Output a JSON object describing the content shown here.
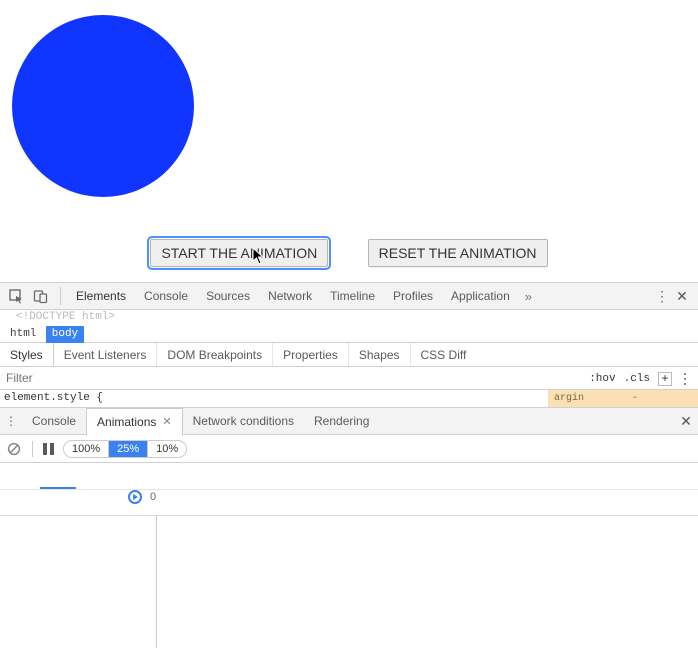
{
  "page": {
    "circle_color": "#1035ff",
    "start_btn": "START THE ANIMATION",
    "reset_btn": "RESET THE ANIMATION"
  },
  "devtools": {
    "tabs": [
      "Elements",
      "Console",
      "Sources",
      "Network",
      "Timeline",
      "Profiles",
      "Application"
    ],
    "active_tab": "Elements",
    "overflow_glyph": "»",
    "doctype": "<!DOCTYPE html>",
    "crumbs": {
      "root": "html",
      "selected": "body"
    },
    "styles_tabs": [
      "Styles",
      "Event Listeners",
      "DOM Breakpoints",
      "Properties",
      "Shapes",
      "CSS Diff"
    ],
    "filter_placeholder": "Filter",
    "hov": ":hov",
    "cls": ".cls",
    "element_style": "element.style {",
    "margin_label": "argin",
    "margin_dash": "-"
  },
  "drawer": {
    "tabs": [
      "Console",
      "Animations",
      "Network conditions",
      "Rendering"
    ],
    "active_tab": "Animations",
    "speeds": [
      "100%",
      "25%",
      "10%"
    ],
    "speed_selected": "25%",
    "marker_value": "0"
  }
}
